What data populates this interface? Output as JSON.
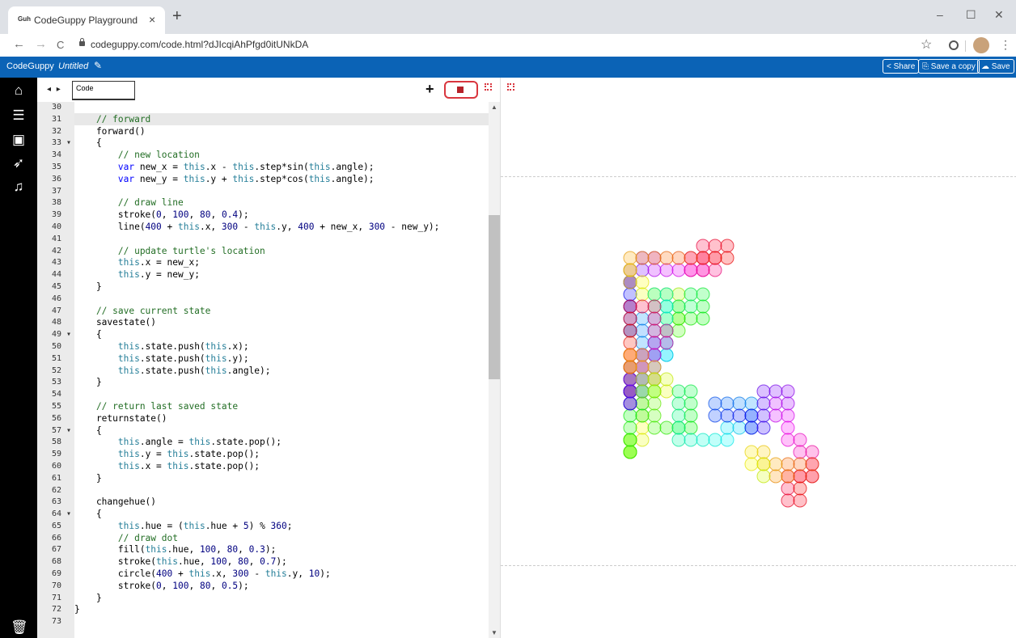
{
  "browser": {
    "tab_title": "CodeGuppy Playground",
    "favicon_text": "Guh",
    "tab_close": "×",
    "new_tab": "+",
    "url": "codeguppy.com/code.html?dJIcqiAhPfgd0itUNkDA",
    "back": "←",
    "forward": "→",
    "reload": "C",
    "star": "☆",
    "menu": "⋮",
    "win_min": "–",
    "win_max": "☐",
    "win_close": "✕"
  },
  "app": {
    "name": "CodeGuppy",
    "document": "Untitled",
    "share_label": "Share",
    "save_copy_label": "Save a copy",
    "save_label": "Save"
  },
  "sidebar": [
    "home-icon",
    "menu-icon",
    "image-icon",
    "rocket-icon",
    "music-icon",
    "trash-icon"
  ],
  "editor": {
    "tab_label": "Code",
    "arrows": "◂ ▸",
    "plus": "+",
    "first_line": 30,
    "lines": [
      "",
      "    // forward",
      "    forward()",
      "    {",
      "        // new location",
      "        var new_x = this.x - this.step*sin(this.angle);",
      "        var new_y = this.y + this.step*cos(this.angle);",
      "",
      "        // draw line",
      "        stroke(0, 100, 80, 0.4);",
      "        line(400 + this.x, 300 - this.y, 400 + new_x, 300 - new_y);",
      "",
      "        // update turtle's location",
      "        this.x = new_x;",
      "        this.y = new_y;",
      "    }",
      "",
      "    // save current state",
      "    savestate()",
      "    {",
      "        this.state.push(this.x);",
      "        this.state.push(this.y);",
      "        this.state.push(this.angle);",
      "    }",
      "",
      "    // return last saved state",
      "    returnstate()",
      "    {",
      "        this.angle = this.state.pop();",
      "        this.y = this.state.pop();",
      "        this.x = this.state.pop();",
      "    }",
      "",
      "    changehue()",
      "    {",
      "        this.hue = (this.hue + 5) % 360;",
      "        // draw dot",
      "        fill(this.hue, 100, 80, 0.3);",
      "        stroke(this.hue, 100, 80, 0.7);",
      "        circle(400 + this.x, 300 - this.y, 10);",
      "        stroke(0, 100, 80, 0.5);",
      "    }",
      "}",
      ""
    ],
    "fold_lines": [
      33,
      49,
      57,
      64
    ]
  },
  "colors": {
    "accent": "#0b63b6",
    "stop_border": "#d9363e",
    "comment": "#236e25"
  }
}
